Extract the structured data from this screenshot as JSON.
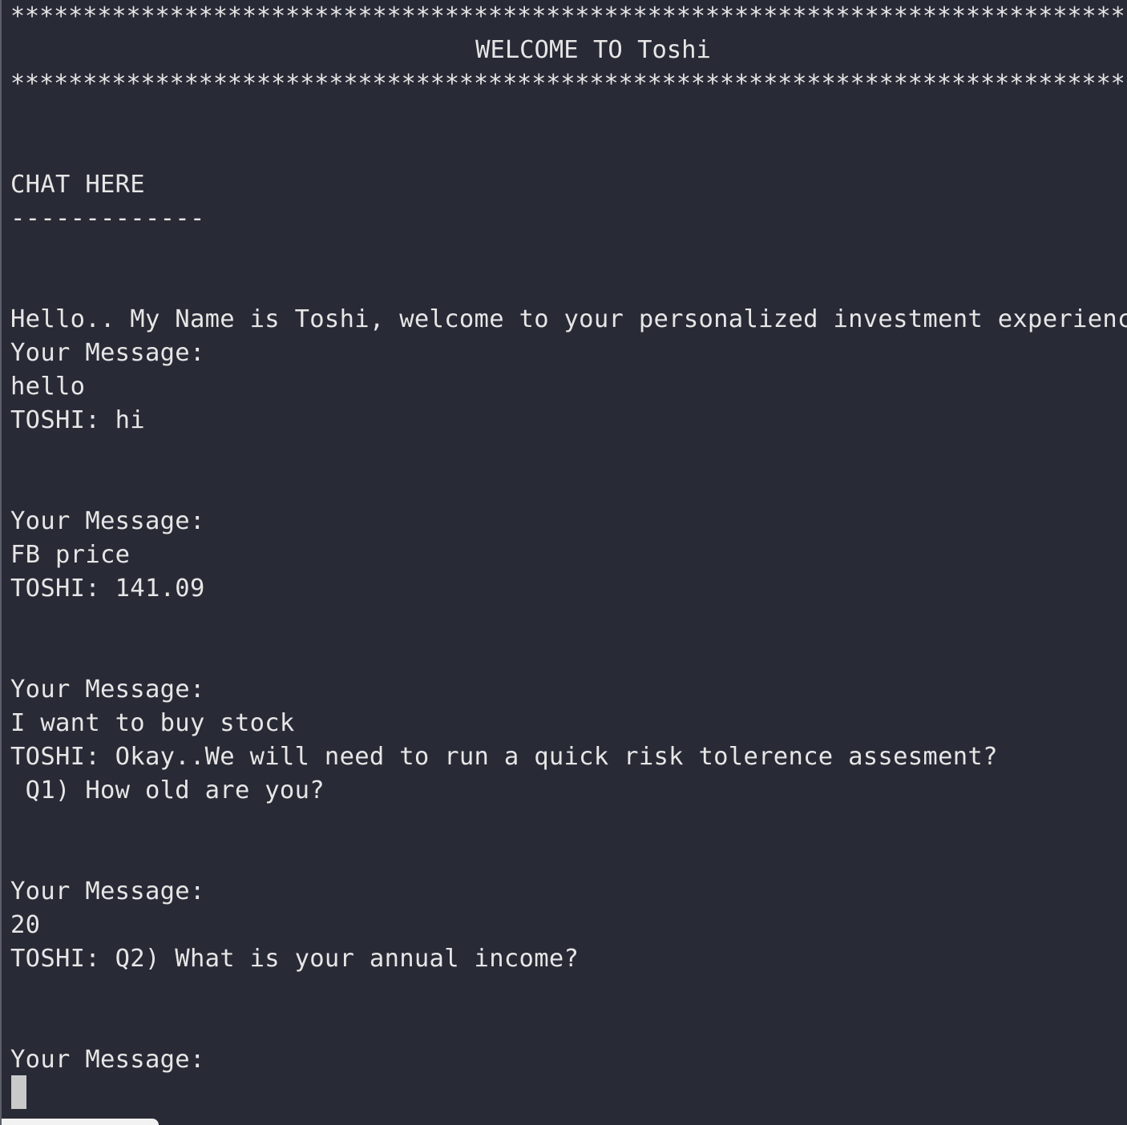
{
  "banner": {
    "top_rule": "******************************************************************************",
    "title": "WELCOME TO Toshi",
    "bottom_rule": "******************************************************************************"
  },
  "chat": {
    "heading": "CHAT HERE",
    "underline": "-------------",
    "greeting": "Hello.. My Name is Toshi, welcome to your personalized investment experience",
    "exchanges": [
      {
        "prompt": "Your Message:",
        "user": "hello",
        "reply": "TOSHI: hi"
      },
      {
        "prompt": "Your Message:",
        "user": "FB price",
        "reply": "TOSHI: 141.09"
      },
      {
        "prompt": "Your Message:",
        "user": "I want to buy stock",
        "reply": "TOSHI: Okay..We will need to run a quick risk tolerence assesment?",
        "reply_cont": " Q1) How old are you?"
      },
      {
        "prompt": "Your Message:",
        "user": "20",
        "reply": "TOSHI: Q2) What is your annual income?"
      }
    ],
    "current_prompt": "Your Message:"
  }
}
